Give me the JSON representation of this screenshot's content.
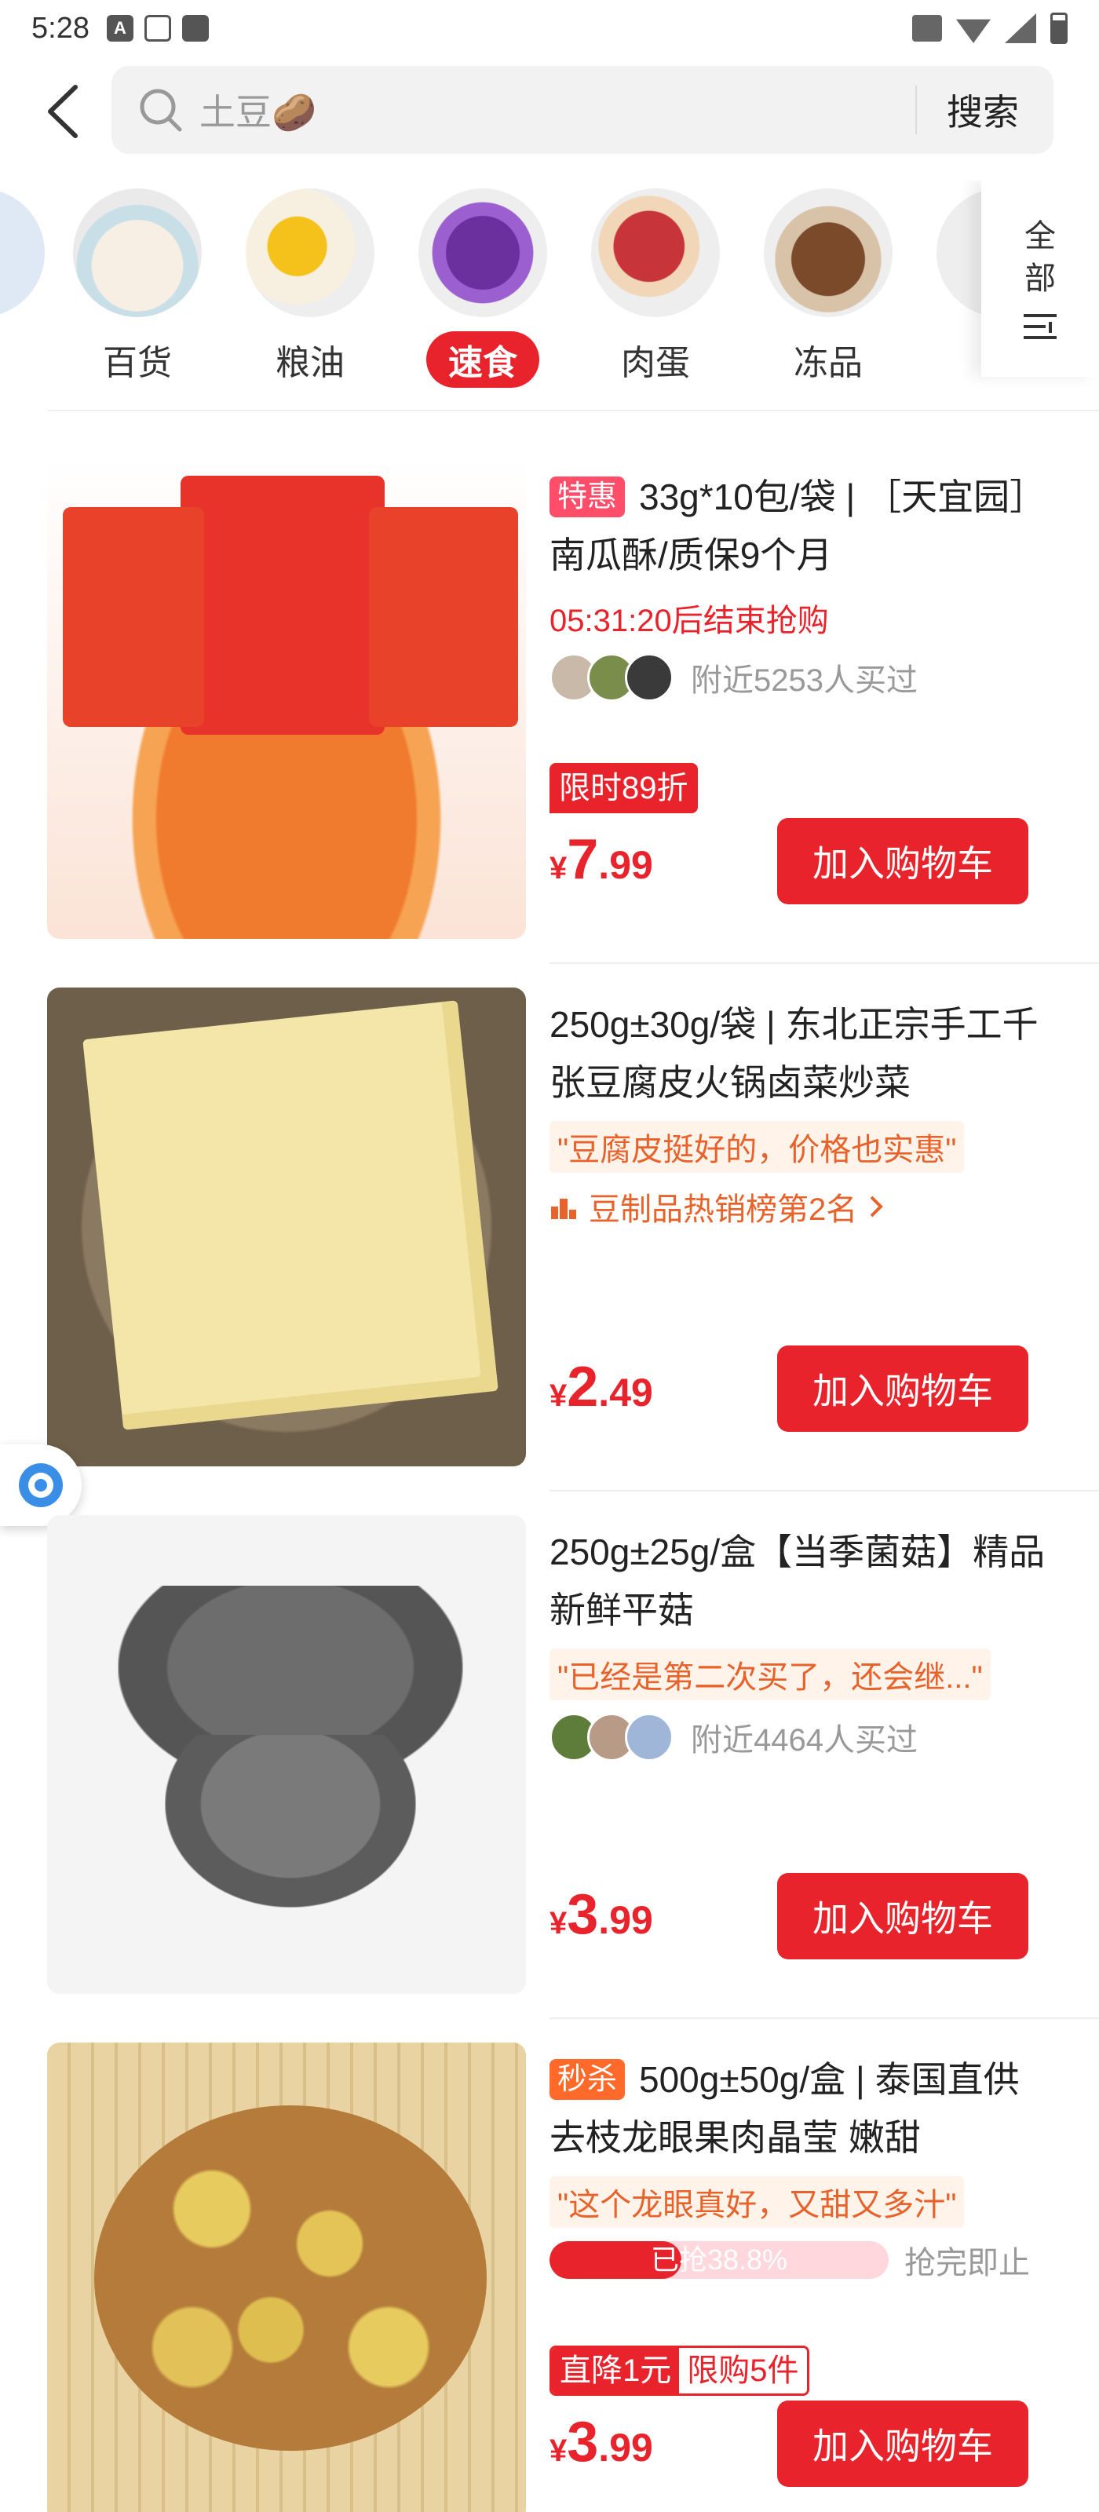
{
  "status_bar": {
    "time": "5:28"
  },
  "search": {
    "query": "土豆🥔",
    "button": "搜索"
  },
  "categories": [
    {
      "label": "百货",
      "active": false
    },
    {
      "label": "粮油",
      "active": false
    },
    {
      "label": "速食",
      "active": true
    },
    {
      "label": "肉蛋",
      "active": false
    },
    {
      "label": "冻品",
      "active": false
    }
  ],
  "all_categories": "全部",
  "products": [
    {
      "tag": "特惠",
      "title": "33g*10包/袋 | ［天宜园］南瓜酥/质保9个月",
      "countdown": "05:31:20后结束抢购",
      "buyers": "附近5253人买过",
      "promo": "限时89折",
      "price_currency": "¥",
      "price_int": "7",
      "price_dec": ".99",
      "cart": "加入购物车"
    },
    {
      "title": "250g±30g/袋 | 东北正宗手工千张豆腐皮火锅卤菜炒菜",
      "quote": "\"豆腐皮挺好的，价格也实惠\"",
      "rank": "豆制品热销榜第2名",
      "price_currency": "¥",
      "price_int": "2",
      "price_dec": ".49",
      "cart": "加入购物车"
    },
    {
      "title": "250g±25g/盒【当季菌菇】精品新鲜平菇",
      "quote": "\"已经是第二次买了，还会继...\"",
      "buyers": "附近4464人买过",
      "price_currency": "¥",
      "price_int": "3",
      "price_dec": ".99",
      "cart": "加入购物车"
    },
    {
      "tag": "秒杀",
      "title": "500g±50g/盒 | 泰国直供 去枝龙眼果肉晶莹 嫩甜",
      "quote": "\"这个龙眼真好，又甜又多汁\"",
      "progress_text": "已抢38.8%",
      "progress_value": 38.8,
      "progress_after": "抢完即止",
      "promo_left": "直降1元",
      "promo_right": "限购5件",
      "price_currency": "¥",
      "price_int": "3",
      "price_dec": ".99",
      "cart": "加入购物车"
    }
  ],
  "colors": {
    "accent": "#e8232b",
    "special_tag": "#ff4d6a",
    "seckill_tag": "#ff6a2b",
    "quote": "#e8632b"
  }
}
